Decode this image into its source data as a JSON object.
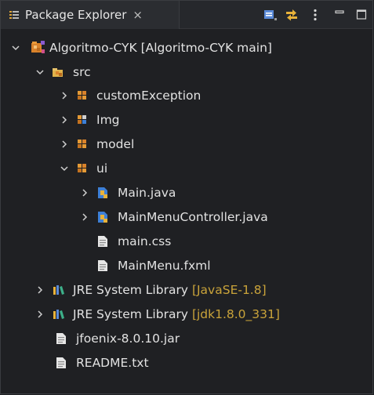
{
  "view": {
    "title": "Package Explorer",
    "close_symbol": "×"
  },
  "tree": {
    "project": {
      "label": "Algoritmo-CYK",
      "decoration": "[Algoritmo-CYK main]"
    },
    "src": {
      "label": "src"
    },
    "packages": {
      "customException": {
        "label": "customException"
      },
      "img": {
        "label": "Img"
      },
      "model": {
        "label": "model"
      },
      "ui": {
        "label": "ui"
      }
    },
    "ui_files": {
      "main_java": {
        "label": "Main.java"
      },
      "menu_controller": {
        "label": "MainMenuController.java"
      },
      "main_css": {
        "label": "main.css"
      },
      "main_menu_fxml": {
        "label": "MainMenu.fxml"
      }
    },
    "libraries": {
      "jre1": {
        "label": "JRE System Library",
        "decoration": "[JavaSE-1.8]"
      },
      "jre2": {
        "label": "JRE System Library",
        "decoration": "[jdk1.8.0_331]"
      }
    },
    "root_files": {
      "jfoenix": {
        "label": "jfoenix-8.0.10.jar"
      },
      "readme": {
        "label": "README.txt"
      }
    }
  },
  "icons": {
    "package_explorer": "package-explorer-icon",
    "collapse_all": "collapse-all-icon",
    "link_editor": "link-with-editor-icon",
    "view_menu": "view-menu-icon",
    "minimize": "minimize-icon",
    "maximize": "maximize-icon"
  },
  "colors": {
    "background": "#1f2023",
    "text": "#e2e2e2",
    "decoration": "#c9a33a",
    "package_orange": "#d9822b",
    "java_blue": "#3d7fd6"
  }
}
